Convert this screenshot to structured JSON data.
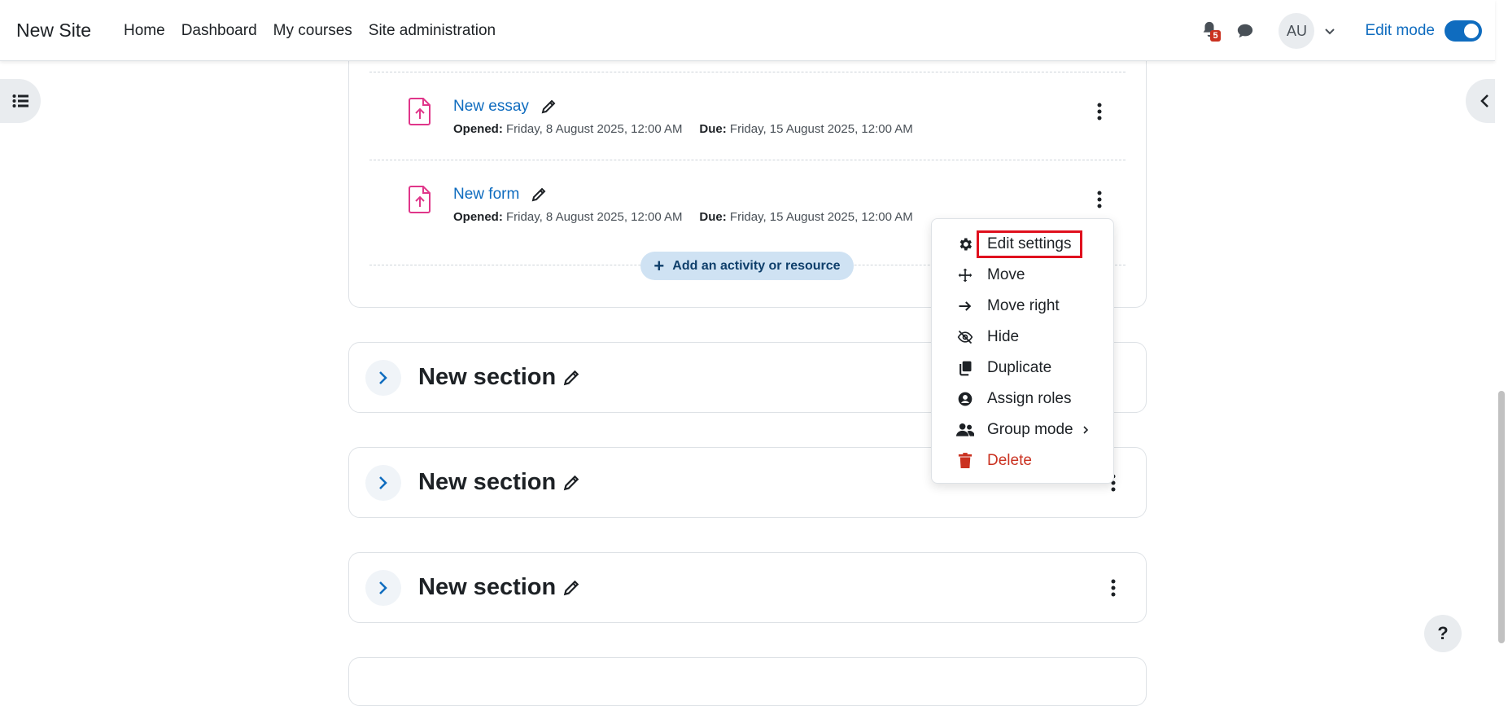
{
  "navbar": {
    "brand": "New Site",
    "links": [
      "Home",
      "Dashboard",
      "My courses",
      "Site administration"
    ],
    "notification_count": "5",
    "avatar_initials": "AU",
    "edit_mode_label": "Edit mode",
    "edit_mode_on": true
  },
  "activities": [
    {
      "title": "New essay",
      "opened_label": "Opened:",
      "opened_value": "Friday, 8 August 2025, 12:00 AM",
      "due_label": "Due:",
      "due_value": "Friday, 15 August 2025, 12:00 AM"
    },
    {
      "title": "New form",
      "opened_label": "Opened:",
      "opened_value": "Friday, 8 August 2025, 12:00 AM",
      "due_label": "Due:",
      "due_value": "Friday, 15 August 2025, 12:00 AM"
    }
  ],
  "add_activity_label": "Add an activity or resource",
  "sections": [
    {
      "title": "New section"
    },
    {
      "title": "New section"
    },
    {
      "title": "New section"
    }
  ],
  "context_menu": {
    "items": [
      {
        "label": "Edit settings",
        "icon": "gear-icon"
      },
      {
        "label": "Move",
        "icon": "move-icon"
      },
      {
        "label": "Move right",
        "icon": "arrow-right-icon"
      },
      {
        "label": "Hide",
        "icon": "eye-slash-icon"
      },
      {
        "label": "Duplicate",
        "icon": "copy-icon"
      },
      {
        "label": "Assign roles",
        "icon": "user-circle-icon"
      },
      {
        "label": "Group mode",
        "icon": "users-icon"
      },
      {
        "label": "Delete",
        "icon": "trash-icon"
      }
    ]
  },
  "help_label": "?",
  "colors": {
    "link": "#0f6cbf",
    "danger": "#ca3120",
    "activity_icon": "#e0368a",
    "highlight": "#e0101e"
  }
}
